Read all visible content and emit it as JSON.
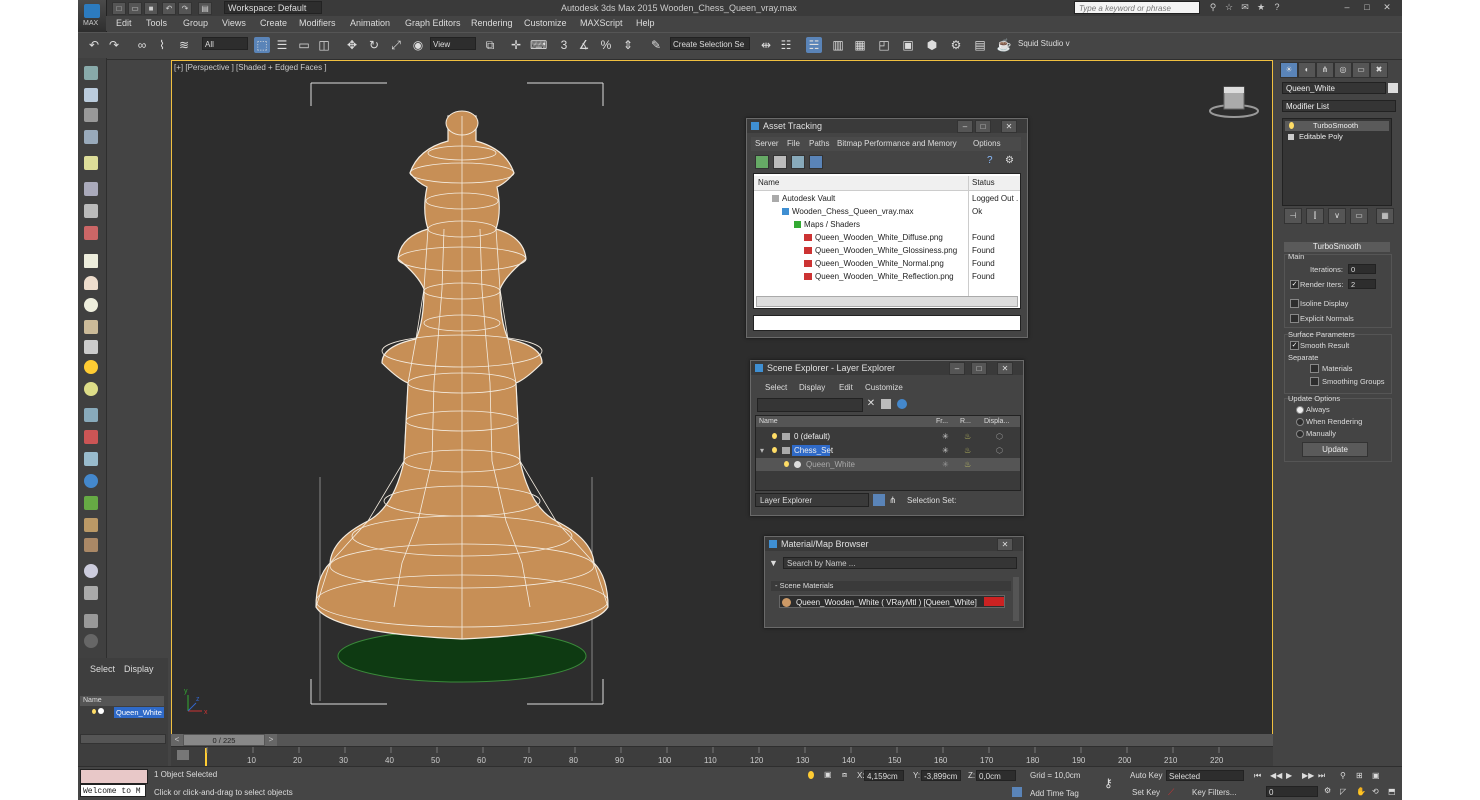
{
  "window": {
    "app_title": "Autodesk 3ds Max  2015     Wooden_Chess_Queen_vray.max",
    "logo_text": "MAX",
    "workspace": "Workspace: Default",
    "search_placeholder": "Type a keyword or phrase"
  },
  "menu": [
    "Edit",
    "Tools",
    "Group",
    "Views",
    "Create",
    "Modifiers",
    "Animation",
    "Graph Editors",
    "Rendering",
    "Customize",
    "MAXScript",
    "Help"
  ],
  "toolbar": {
    "filter": "All",
    "ref_coord": "View",
    "selection_set": "Create Selection Se",
    "snap_3": "3",
    "snap_percent": "%",
    "workspace_user": "Squid Studio v"
  },
  "viewport": {
    "label": "[+] [Perspective ] [Shaded + Edged Faces ]",
    "axis_x": "x",
    "axis_y": "y",
    "axis_z": "z"
  },
  "asset_tracking": {
    "title": "Asset Tracking",
    "menu": [
      "Server",
      "File",
      "Paths",
      "Bitmap Performance and Memory",
      "Options"
    ],
    "columns": [
      "Name",
      "Status"
    ],
    "rows": [
      {
        "name": "Autodesk Vault",
        "status": "Logged Out ."
      },
      {
        "name": "Wooden_Chess_Queen_vray.max",
        "status": "Ok"
      },
      {
        "name": "Maps / Shaders",
        "status": ""
      },
      {
        "name": "Queen_Wooden_White_Diffuse.png",
        "status": "Found"
      },
      {
        "name": "Queen_Wooden_White_Glossiness.png",
        "status": "Found"
      },
      {
        "name": "Queen_Wooden_White_Normal.png",
        "status": "Found"
      },
      {
        "name": "Queen_Wooden_White_Reflection.png",
        "status": "Found"
      }
    ]
  },
  "scene_explorer": {
    "title": "Scene Explorer - Layer Explorer",
    "menu": [
      "Select",
      "Display",
      "Edit",
      "Customize"
    ],
    "columns": [
      "Name",
      "Fr...",
      "R...",
      "Displa..."
    ],
    "rows": [
      {
        "name": "0 (default)"
      },
      {
        "name": "Chess_Set"
      },
      {
        "name": "Queen_White"
      }
    ],
    "footer_dropdown": "Layer Explorer",
    "selection_set_label": "Selection Set:"
  },
  "material_browser": {
    "title": "Material/Map Browser",
    "search_placeholder": "Search by Name ...",
    "group": "- Scene Materials",
    "item": "Queen_Wooden_White  ( VRayMtl ) [Queen_White]"
  },
  "left_panel": {
    "tabs": [
      "Select",
      "Display"
    ],
    "column": "Name",
    "item": "Queen_White"
  },
  "command_panel": {
    "object_name": "Queen_White",
    "modifier_list": "Modifier List",
    "stack": [
      "TurboSmooth",
      "Editable Poly"
    ],
    "rollout_title": "TurboSmooth",
    "main_label": "Main",
    "iterations_label": "Iterations:",
    "iterations_value": "0",
    "render_iters_label": "Render Iters:",
    "render_iters_value": "2",
    "isoline": "Isoline Display",
    "explicit": "Explicit Normals",
    "surface_params": "Surface Parameters",
    "smooth_result": "Smooth Result",
    "separate": "Separate",
    "materials": "Materials",
    "smoothing_groups": "Smoothing Groups",
    "update_options": "Update Options",
    "always": "Always",
    "when_rendering": "When Rendering",
    "manually": "Manually",
    "update_button": "Update"
  },
  "timeline": {
    "frame": "0 / 225",
    "ticks": [
      "10",
      "20",
      "30",
      "40",
      "50",
      "60",
      "70",
      "80",
      "90",
      "100",
      "110",
      "120",
      "130",
      "140",
      "150",
      "160",
      "170",
      "180",
      "190",
      "200",
      "210",
      "220"
    ]
  },
  "status": {
    "script_listener": "Welcome to M",
    "selected": "1 Object Selected",
    "prompt": "Click or click-and-drag to select objects",
    "x_label": "X:",
    "x": "4,159cm",
    "y_label": "Y:",
    "y": "-3,899cm",
    "z_label": "Z:",
    "z": "0,0cm",
    "grid": "Grid = 10,0cm",
    "add_time_tag": "Add Time Tag",
    "auto_key": "Auto Key",
    "set_key": "Set Key",
    "selected_dropdown": "Selected",
    "key_filters": "Key Filters...",
    "frame_field": "0"
  }
}
